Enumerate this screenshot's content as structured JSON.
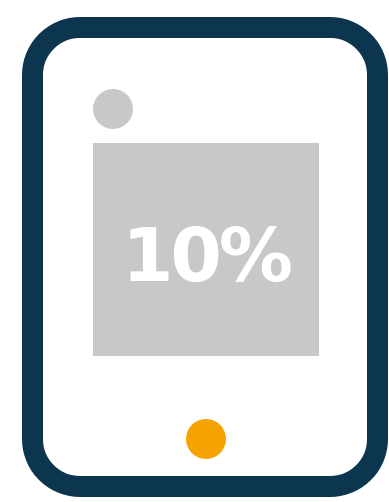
{
  "screen": {
    "value_text": "10%"
  },
  "colors": {
    "frame": "#0c3550",
    "screen": "#c8c8c8",
    "camera": "#c8c8c8",
    "home_button": "#f6a200",
    "text": "#ffffff"
  },
  "icons": {
    "device": "tablet-icon",
    "camera": "camera-dot-icon",
    "home": "home-button-icon"
  }
}
